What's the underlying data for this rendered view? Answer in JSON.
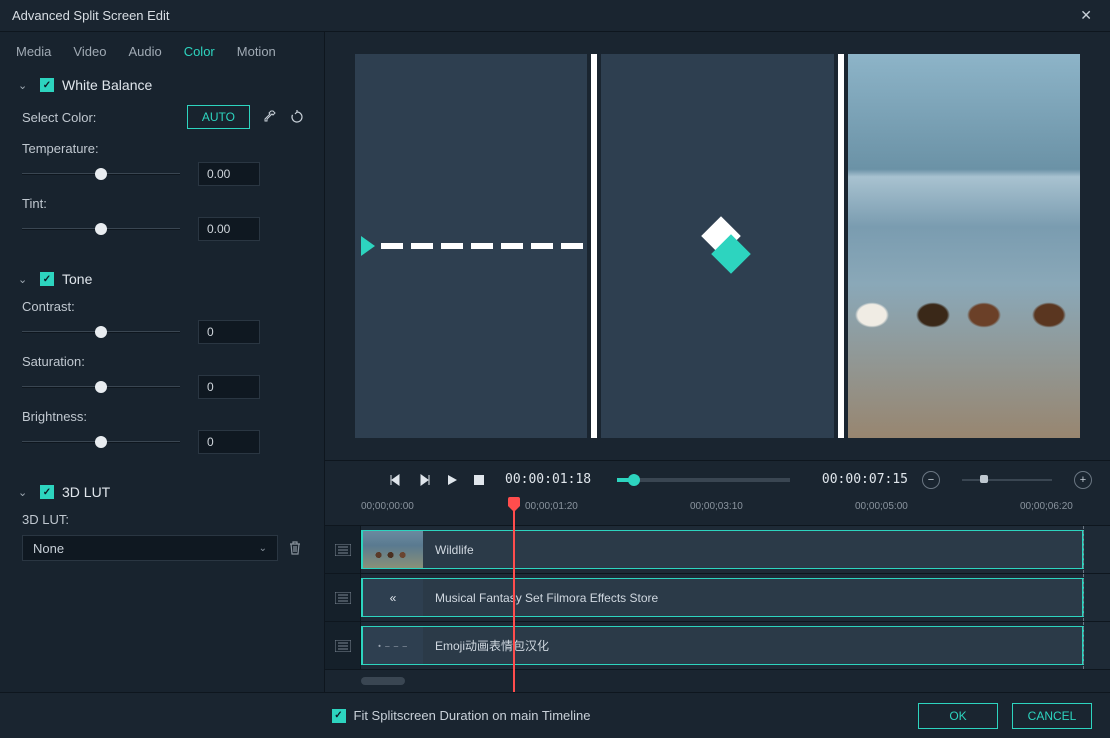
{
  "window": {
    "title": "Advanced Split Screen Edit"
  },
  "tabs": [
    "Media",
    "Video",
    "Audio",
    "Color",
    "Motion"
  ],
  "activeTab": "Color",
  "whiteBalance": {
    "title": "White Balance",
    "selectColorLabel": "Select Color:",
    "autoLabel": "AUTO",
    "temperature": {
      "label": "Temperature:",
      "value": "0.00"
    },
    "tint": {
      "label": "Tint:",
      "value": "0.00"
    }
  },
  "tone": {
    "title": "Tone",
    "contrast": {
      "label": "Contrast:",
      "value": "0"
    },
    "saturation": {
      "label": "Saturation:",
      "value": "0"
    },
    "brightness": {
      "label": "Brightness:",
      "value": "0"
    }
  },
  "lut": {
    "title": "3D LUT",
    "label": "3D LUT:",
    "selected": "None"
  },
  "transport": {
    "currentTime": "00:00:01:18",
    "totalTime": "00:00:07:15"
  },
  "ruler": {
    "ticks": [
      "00;00;00:00",
      "00;00;01:20",
      "00;00;03:10",
      "00;00;05:00",
      "00;00;06:20"
    ]
  },
  "tracks": [
    {
      "name": "Wildlife"
    },
    {
      "name": "Musical Fantasy Set  Filmora Effects Store"
    },
    {
      "name": "Emoji动画表情包汉化"
    }
  ],
  "footer": {
    "fitLabel": "Fit Splitscreen Duration on main Timeline",
    "ok": "OK",
    "cancel": "CANCEL"
  }
}
